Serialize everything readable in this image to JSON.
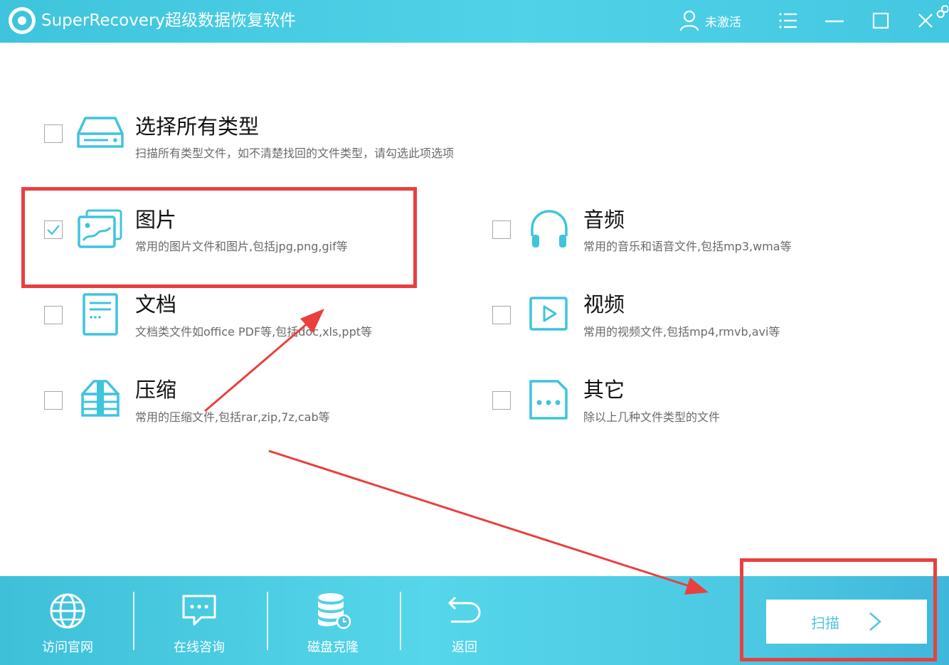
{
  "window": {
    "title": "SuperRecovery超级数据恢复软件",
    "user_label": "未激活"
  },
  "options": [
    {
      "id": "all",
      "title": "选择所有类型",
      "desc": "扫描所有类型文件，如不清楚找回的文件类型，请勾选此项选项",
      "checked": false
    },
    {
      "id": "image",
      "title": "图片",
      "desc": "常用的图片文件和图片,包括jpg,png,gif等",
      "checked": true
    },
    {
      "id": "audio",
      "title": "音频",
      "desc": "常用的音乐和语音文件,包括mp3,wma等",
      "checked": false
    },
    {
      "id": "document",
      "title": "文档",
      "desc": "文档类文件如office PDF等,包括doc,xls,ppt等",
      "checked": false
    },
    {
      "id": "video",
      "title": "视频",
      "desc": "常用的视频文件,包括mp4,rmvb,avi等",
      "checked": false
    },
    {
      "id": "archive",
      "title": "压缩",
      "desc": "常用的压缩文件,包括rar,zip,7z,cab等",
      "checked": false
    },
    {
      "id": "other",
      "title": "其它",
      "desc": "除以上几种文件类型的文件",
      "checked": false
    }
  ],
  "bottom_bar": {
    "items": [
      {
        "label": "访问官网",
        "icon": "globe-icon"
      },
      {
        "label": "在线咨询",
        "icon": "chat-icon"
      },
      {
        "label": "磁盘克隆",
        "icon": "database-icon"
      },
      {
        "label": "返回",
        "icon": "return-arrow-icon"
      }
    ],
    "scan_label": "扫描"
  },
  "colors": {
    "accent": "#4fd3e8",
    "icon": "#3fc4dd",
    "annotation": "#e8403f"
  }
}
